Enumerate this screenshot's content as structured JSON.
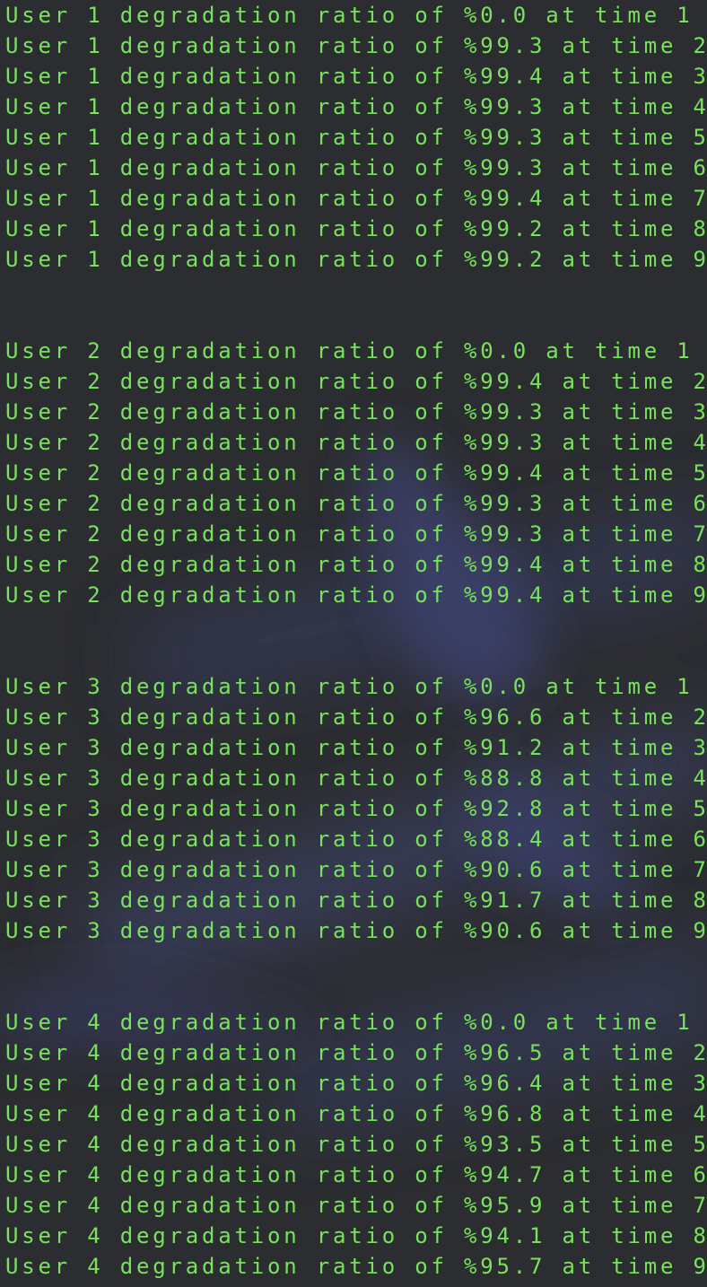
{
  "terminal": {
    "text_color": "#79e25d",
    "background_color": "#2c2d31",
    "blocks": [
      {
        "lines": [
          "User 1 degradation ratio of %0.0 at time 1",
          "User 1 degradation ratio of %99.3 at time 2",
          "User 1 degradation ratio of %99.4 at time 3",
          "User 1 degradation ratio of %99.3 at time 4",
          "User 1 degradation ratio of %99.3 at time 5",
          "User 1 degradation ratio of %99.3 at time 6",
          "User 1 degradation ratio of %99.4 at time 7",
          "User 1 degradation ratio of %99.2 at time 8",
          "User 1 degradation ratio of %99.2 at time 9"
        ]
      },
      {
        "lines": [
          "User 2 degradation ratio of %0.0 at time 1",
          "User 2 degradation ratio of %99.4 at time 2",
          "User 2 degradation ratio of %99.3 at time 3",
          "User 2 degradation ratio of %99.3 at time 4",
          "User 2 degradation ratio of %99.4 at time 5",
          "User 2 degradation ratio of %99.3 at time 6",
          "User 2 degradation ratio of %99.3 at time 7",
          "User 2 degradation ratio of %99.4 at time 8",
          "User 2 degradation ratio of %99.4 at time 9"
        ]
      },
      {
        "lines": [
          "User 3 degradation ratio of %0.0 at time 1",
          "User 3 degradation ratio of %96.6 at time 2",
          "User 3 degradation ratio of %91.2 at time 3",
          "User 3 degradation ratio of %88.8 at time 4",
          "User 3 degradation ratio of %92.8 at time 5",
          "User 3 degradation ratio of %88.4 at time 6",
          "User 3 degradation ratio of %90.6 at time 7",
          "User 3 degradation ratio of %91.7 at time 8",
          "User 3 degradation ratio of %90.6 at time 9"
        ]
      },
      {
        "lines": [
          "User 4 degradation ratio of %0.0 at time 1",
          "User 4 degradation ratio of %96.5 at time 2",
          "User 4 degradation ratio of %96.4 at time 3",
          "User 4 degradation ratio of %96.8 at time 4",
          "User 4 degradation ratio of %93.5 at time 5",
          "User 4 degradation ratio of %94.7 at time 6",
          "User 4 degradation ratio of %95.9 at time 7",
          "User 4 degradation ratio of %94.1 at time 8",
          "User 4 degradation ratio of %95.7 at time 9"
        ]
      }
    ]
  }
}
